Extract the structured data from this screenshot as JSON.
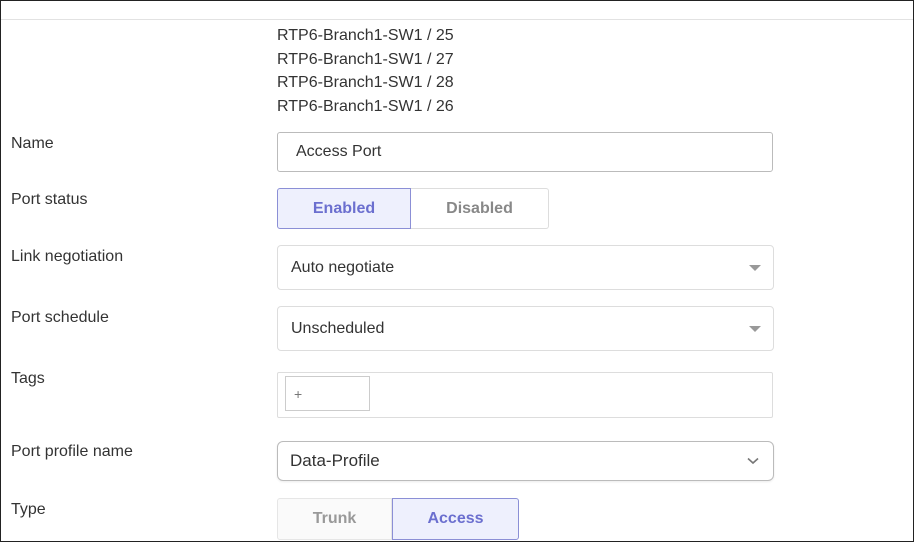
{
  "ports": [
    "RTP6-Branch1-SW1 / 25",
    "RTP6-Branch1-SW1 / 27",
    "RTP6-Branch1-SW1 / 28",
    "RTP6-Branch1-SW1 / 26"
  ],
  "fields": {
    "name": {
      "label": "Name",
      "value": "Access Port"
    },
    "port_status": {
      "label": "Port status",
      "options": [
        "Enabled",
        "Disabled"
      ],
      "selected": "Enabled"
    },
    "link_negotiation": {
      "label": "Link negotiation",
      "value": "Auto negotiate"
    },
    "port_schedule": {
      "label": "Port schedule",
      "value": "Unscheduled"
    },
    "tags": {
      "label": "Tags",
      "add": "+"
    },
    "port_profile": {
      "label": "Port profile name",
      "value": "Data-Profile"
    },
    "type": {
      "label": "Type",
      "options": [
        "Trunk",
        "Access"
      ],
      "selected": "Access"
    }
  },
  "colors": {
    "accent": "#6b6fcf",
    "accent_bg": "#eef0fd"
  }
}
